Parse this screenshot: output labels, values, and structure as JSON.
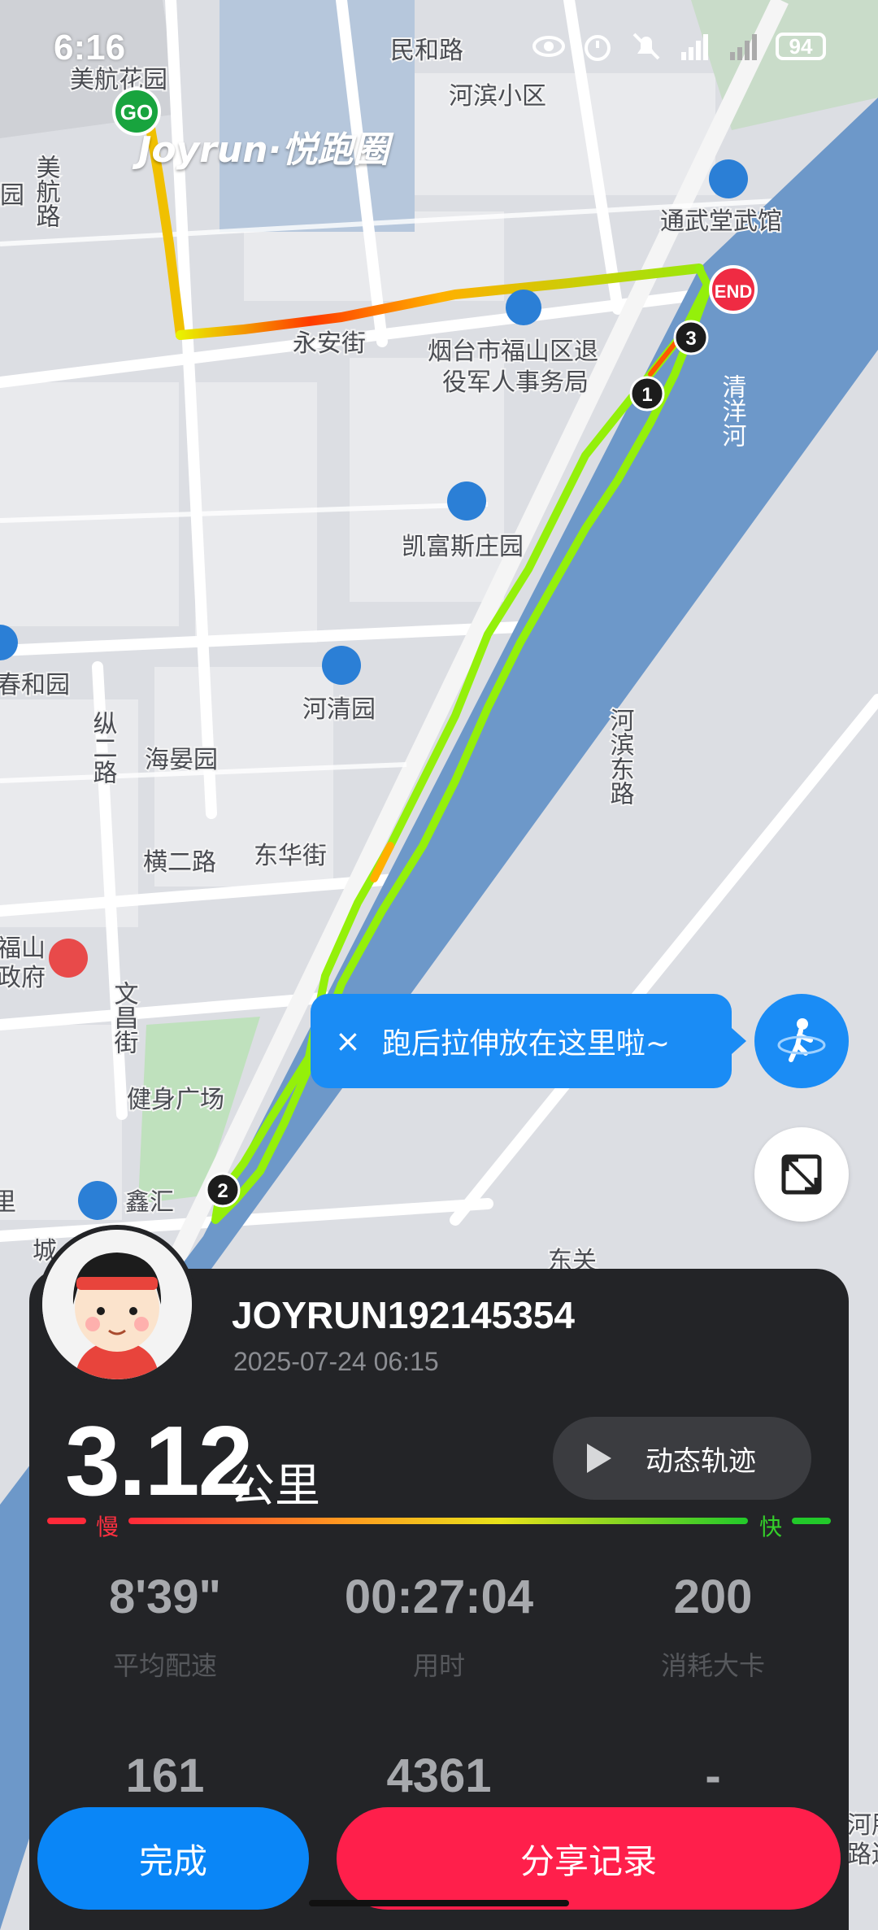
{
  "status_bar": {
    "time": "6:16",
    "battery": "94"
  },
  "map": {
    "watermark": "Joyrun·悦跑圈",
    "labels": [
      "美航花园",
      "民和路",
      "河滨小区",
      "美航路",
      "花园",
      "通武堂武馆",
      "永安街",
      "烟台市福山区退",
      "役军人事务局",
      "清洋河",
      "凯富斯庄园",
      "春和园",
      "纵二路",
      "海晏园",
      "河清园",
      "河滨东路",
      "横二路",
      "东华街",
      "福山",
      "政府",
      "文昌街",
      "健身广场",
      "鑫汇",
      "城",
      "里",
      "东关",
      "河朋",
      "路边"
    ],
    "start_marker": "GO",
    "end_marker": "END",
    "km_markers": [
      "1",
      "2",
      "3"
    ]
  },
  "tooltip": {
    "close": "×",
    "text": "跑后拉伸放在这里啦~"
  },
  "icons": {
    "stretch": "stretch-runner-icon",
    "expand": "expand-map-icon",
    "close": "close-icon",
    "play": "play-icon"
  },
  "user": {
    "name": "JOYRUN192145354",
    "datetime": "2025-07-24 06:15"
  },
  "distance": {
    "value": "3.12",
    "unit": "公里"
  },
  "replay_label": "动态轨迹",
  "pace_legend": {
    "slow": "慢",
    "fast": "快"
  },
  "stats": [
    {
      "value": "8'39\"",
      "label": "平均配速"
    },
    {
      "value": "00:27:04",
      "label": "用时"
    },
    {
      "value": "200",
      "label": "消耗大卡"
    },
    {
      "value": "161",
      "label": ""
    },
    {
      "value": "4361",
      "label": ""
    },
    {
      "value": "-",
      "label": ""
    }
  ],
  "buttons": {
    "done": "完成",
    "share": "分享记录"
  },
  "colors": {
    "accent_blue": "#0a86f7",
    "share_red": "#ff1f4b",
    "panel": "#232427",
    "route_fast": "#8bee10",
    "route_slow": "#ff2a00",
    "river": "#6d98c9"
  }
}
